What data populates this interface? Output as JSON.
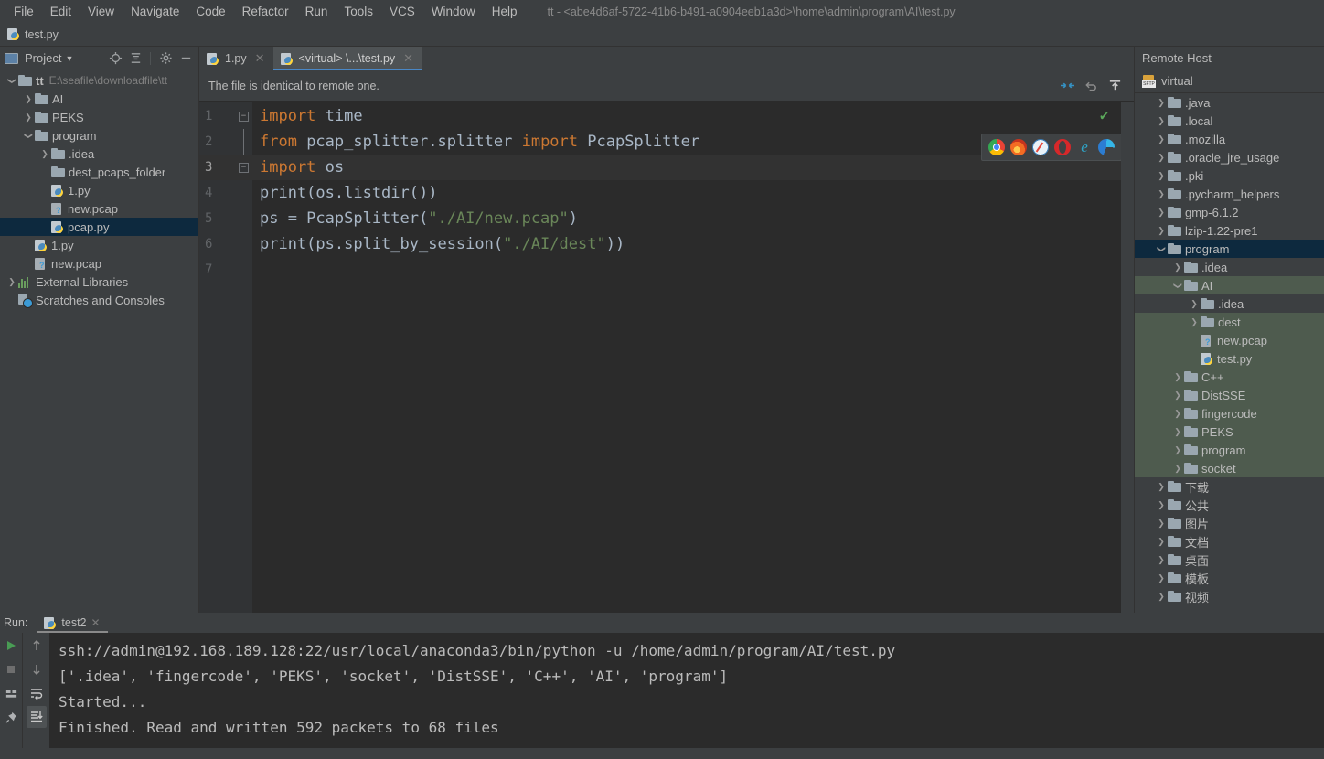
{
  "window": {
    "title": "tt - <abe4d6af-5722-41b6-b491-a0904eeb1a3d>\\home\\admin\\program\\AI\\test.py"
  },
  "menubar": {
    "items": [
      "File",
      "Edit",
      "View",
      "Navigate",
      "Code",
      "Refactor",
      "Run",
      "Tools",
      "VCS",
      "Window",
      "Help"
    ]
  },
  "navbar": {
    "file": "test.py"
  },
  "project_panel": {
    "title": "Project",
    "icons": [
      "locate-icon",
      "collapse-all-icon",
      "settings-gear-icon",
      "hide-icon"
    ],
    "tree": [
      {
        "label": "tt",
        "hint": "E:\\seafile\\downloadfile\\tt",
        "indent": 0,
        "arrow": "down",
        "icon": "folder",
        "bold": true,
        "state": "none"
      },
      {
        "label": "AI",
        "hint": "",
        "indent": 1,
        "arrow": "right",
        "icon": "folder",
        "bold": false,
        "state": "none"
      },
      {
        "label": "PEKS",
        "hint": "",
        "indent": 1,
        "arrow": "right",
        "icon": "folder",
        "bold": false,
        "state": "none"
      },
      {
        "label": "program",
        "hint": "",
        "indent": 1,
        "arrow": "down",
        "icon": "folder",
        "bold": false,
        "state": "none"
      },
      {
        "label": ".idea",
        "hint": "",
        "indent": 2,
        "arrow": "right",
        "icon": "folder",
        "bold": false,
        "state": "none"
      },
      {
        "label": "dest_pcaps_folder",
        "hint": "",
        "indent": 2,
        "arrow": "none",
        "icon": "folder",
        "bold": false,
        "state": "none"
      },
      {
        "label": "1.py",
        "hint": "",
        "indent": 2,
        "arrow": "none",
        "icon": "python",
        "bold": false,
        "state": "none"
      },
      {
        "label": "new.pcap",
        "hint": "",
        "indent": 2,
        "arrow": "none",
        "icon": "unknown",
        "bold": false,
        "state": "none"
      },
      {
        "label": "pcap.py",
        "hint": "",
        "indent": 2,
        "arrow": "none",
        "icon": "python",
        "bold": false,
        "state": "selected"
      },
      {
        "label": "1.py",
        "hint": "",
        "indent": 1,
        "arrow": "none",
        "icon": "python",
        "bold": false,
        "state": "none"
      },
      {
        "label": "new.pcap",
        "hint": "",
        "indent": 1,
        "arrow": "none",
        "icon": "unknown",
        "bold": false,
        "state": "none"
      },
      {
        "label": "External Libraries",
        "hint": "",
        "indent": 0,
        "arrow": "right",
        "icon": "library",
        "bold": false,
        "state": "none"
      },
      {
        "label": "Scratches and Consoles",
        "hint": "",
        "indent": 0,
        "arrow": "none",
        "icon": "scratch",
        "bold": false,
        "state": "none"
      }
    ]
  },
  "editor": {
    "tabs": [
      {
        "label": "1.py",
        "icon": "python",
        "active": false
      },
      {
        "label": "<virtual> \\...\\test.py",
        "icon": "python",
        "active": true
      }
    ],
    "notification": "The file is identical to remote one.",
    "notification_icons": [
      "compare-diff-icon",
      "undo-icon",
      "upload-icon"
    ],
    "inspection_status": "✔",
    "browser_popup": {
      "browsers": [
        "chrome-icon",
        "firefox-icon",
        "safari-icon",
        "opera-icon",
        "ie-icon",
        "edge-icon"
      ]
    },
    "line_numbers": [
      "1",
      "2",
      "3",
      "4",
      "5",
      "6",
      "7"
    ],
    "current_line": 3,
    "code_lines": [
      {
        "n": 1,
        "tokens": [
          {
            "t": "import",
            "c": "kw"
          },
          {
            "t": " time",
            "c": "id"
          }
        ],
        "fold": "open"
      },
      {
        "n": 2,
        "tokens": [
          {
            "t": "from",
            "c": "kw"
          },
          {
            "t": " pcap_splitter.splitter ",
            "c": "id"
          },
          {
            "t": "import",
            "c": "kw"
          },
          {
            "t": " PcapSplitter",
            "c": "id"
          }
        ],
        "fold": "none"
      },
      {
        "n": 3,
        "tokens": [
          {
            "t": "import",
            "c": "kw"
          },
          {
            "t": " os",
            "c": "id"
          }
        ],
        "fold": "close"
      },
      {
        "n": 4,
        "tokens": [
          {
            "t": "print(os.listdir())",
            "c": "id"
          }
        ],
        "fold": "none"
      },
      {
        "n": 5,
        "tokens": [
          {
            "t": "ps = PcapSplitter(",
            "c": "id"
          },
          {
            "t": "\"./AI/new.pcap\"",
            "c": "str"
          },
          {
            "t": ")",
            "c": "id"
          }
        ],
        "fold": "none"
      },
      {
        "n": 6,
        "tokens": [
          {
            "t": "print(ps.split_by_session(",
            "c": "id"
          },
          {
            "t": "\"./AI/dest\"",
            "c": "str"
          },
          {
            "t": "))",
            "c": "id"
          }
        ],
        "fold": "none"
      },
      {
        "n": 7,
        "tokens": [
          {
            "t": "",
            "c": "id"
          }
        ],
        "fold": "none"
      }
    ]
  },
  "remote_panel": {
    "title": "Remote Host",
    "root": "virtual",
    "tree": [
      {
        "label": ".java",
        "indent": 1,
        "arrow": "right",
        "icon": "folder",
        "state": "none"
      },
      {
        "label": ".local",
        "indent": 1,
        "arrow": "right",
        "icon": "folder",
        "state": "none"
      },
      {
        "label": ".mozilla",
        "indent": 1,
        "arrow": "right",
        "icon": "folder",
        "state": "none"
      },
      {
        "label": ".oracle_jre_usage",
        "indent": 1,
        "arrow": "right",
        "icon": "folder",
        "state": "none"
      },
      {
        "label": ".pki",
        "indent": 1,
        "arrow": "right",
        "icon": "folder",
        "state": "none"
      },
      {
        "label": ".pycharm_helpers",
        "indent": 1,
        "arrow": "right",
        "icon": "folder",
        "state": "none"
      },
      {
        "label": "gmp-6.1.2",
        "indent": 1,
        "arrow": "right",
        "icon": "folder",
        "state": "none"
      },
      {
        "label": "lzip-1.22-pre1",
        "indent": 1,
        "arrow": "right",
        "icon": "folder",
        "state": "none"
      },
      {
        "label": "program",
        "indent": 1,
        "arrow": "down",
        "icon": "folder",
        "state": "selected"
      },
      {
        "label": ".idea",
        "indent": 2,
        "arrow": "right",
        "icon": "folder",
        "state": "none"
      },
      {
        "label": "AI",
        "indent": 2,
        "arrow": "down",
        "icon": "folder",
        "state": "shaded"
      },
      {
        "label": ".idea",
        "indent": 3,
        "arrow": "right",
        "icon": "folder",
        "state": "none"
      },
      {
        "label": "dest",
        "indent": 3,
        "arrow": "right",
        "icon": "folder",
        "state": "shaded"
      },
      {
        "label": "new.pcap",
        "indent": 3,
        "arrow": "none",
        "icon": "unknown",
        "state": "shaded"
      },
      {
        "label": "test.py",
        "indent": 3,
        "arrow": "none",
        "icon": "python",
        "state": "shaded"
      },
      {
        "label": "C++",
        "indent": 2,
        "arrow": "right",
        "icon": "folder",
        "state": "shaded"
      },
      {
        "label": "DistSSE",
        "indent": 2,
        "arrow": "right",
        "icon": "folder",
        "state": "shaded"
      },
      {
        "label": "fingercode",
        "indent": 2,
        "arrow": "right",
        "icon": "folder",
        "state": "shaded"
      },
      {
        "label": "PEKS",
        "indent": 2,
        "arrow": "right",
        "icon": "folder",
        "state": "shaded"
      },
      {
        "label": "program",
        "indent": 2,
        "arrow": "right",
        "icon": "folder",
        "state": "shaded"
      },
      {
        "label": "socket",
        "indent": 2,
        "arrow": "right",
        "icon": "folder",
        "state": "shaded"
      },
      {
        "label": "下载",
        "indent": 1,
        "arrow": "right",
        "icon": "folder",
        "state": "none"
      },
      {
        "label": "公共",
        "indent": 1,
        "arrow": "right",
        "icon": "folder",
        "state": "none"
      },
      {
        "label": "图片",
        "indent": 1,
        "arrow": "right",
        "icon": "folder",
        "state": "none"
      },
      {
        "label": "文档",
        "indent": 1,
        "arrow": "right",
        "icon": "folder",
        "state": "none"
      },
      {
        "label": "桌面",
        "indent": 1,
        "arrow": "right",
        "icon": "folder",
        "state": "none"
      },
      {
        "label": "模板",
        "indent": 1,
        "arrow": "right",
        "icon": "folder",
        "state": "none"
      },
      {
        "label": "视频",
        "indent": 1,
        "arrow": "right",
        "icon": "folder",
        "state": "none"
      }
    ]
  },
  "run_panel": {
    "label": "Run:",
    "tab": "test2",
    "left_tools": [
      "run-icon",
      "stop-icon",
      "layout-icon",
      "pin-icon"
    ],
    "right_tools": [
      "up-arrow-icon",
      "down-arrow-icon",
      "soft-wrap-icon",
      "scroll-to-end-icon"
    ],
    "console_lines": [
      "ssh://admin@192.168.189.128:22/usr/local/anaconda3/bin/python -u /home/admin/program/AI/test.py",
      "['.idea', 'fingercode', 'PEKS', 'socket', 'DistSSE', 'C++', 'AI', 'program']",
      "Started...",
      "Finished. Read and written 592 packets to 68 files"
    ]
  },
  "colors": {
    "panel_bg": "#3C3F41",
    "editor_bg": "#2B2B2B",
    "gutter_bg": "#313335",
    "selection_blue": "#0D293E",
    "shaded_green": "#4E5B4E",
    "tab_underline": "#4A88C7",
    "keyword": "#CC7832",
    "string": "#6A8759",
    "identifier": "#A9B7C6",
    "ok_check": "#5BA85B"
  }
}
